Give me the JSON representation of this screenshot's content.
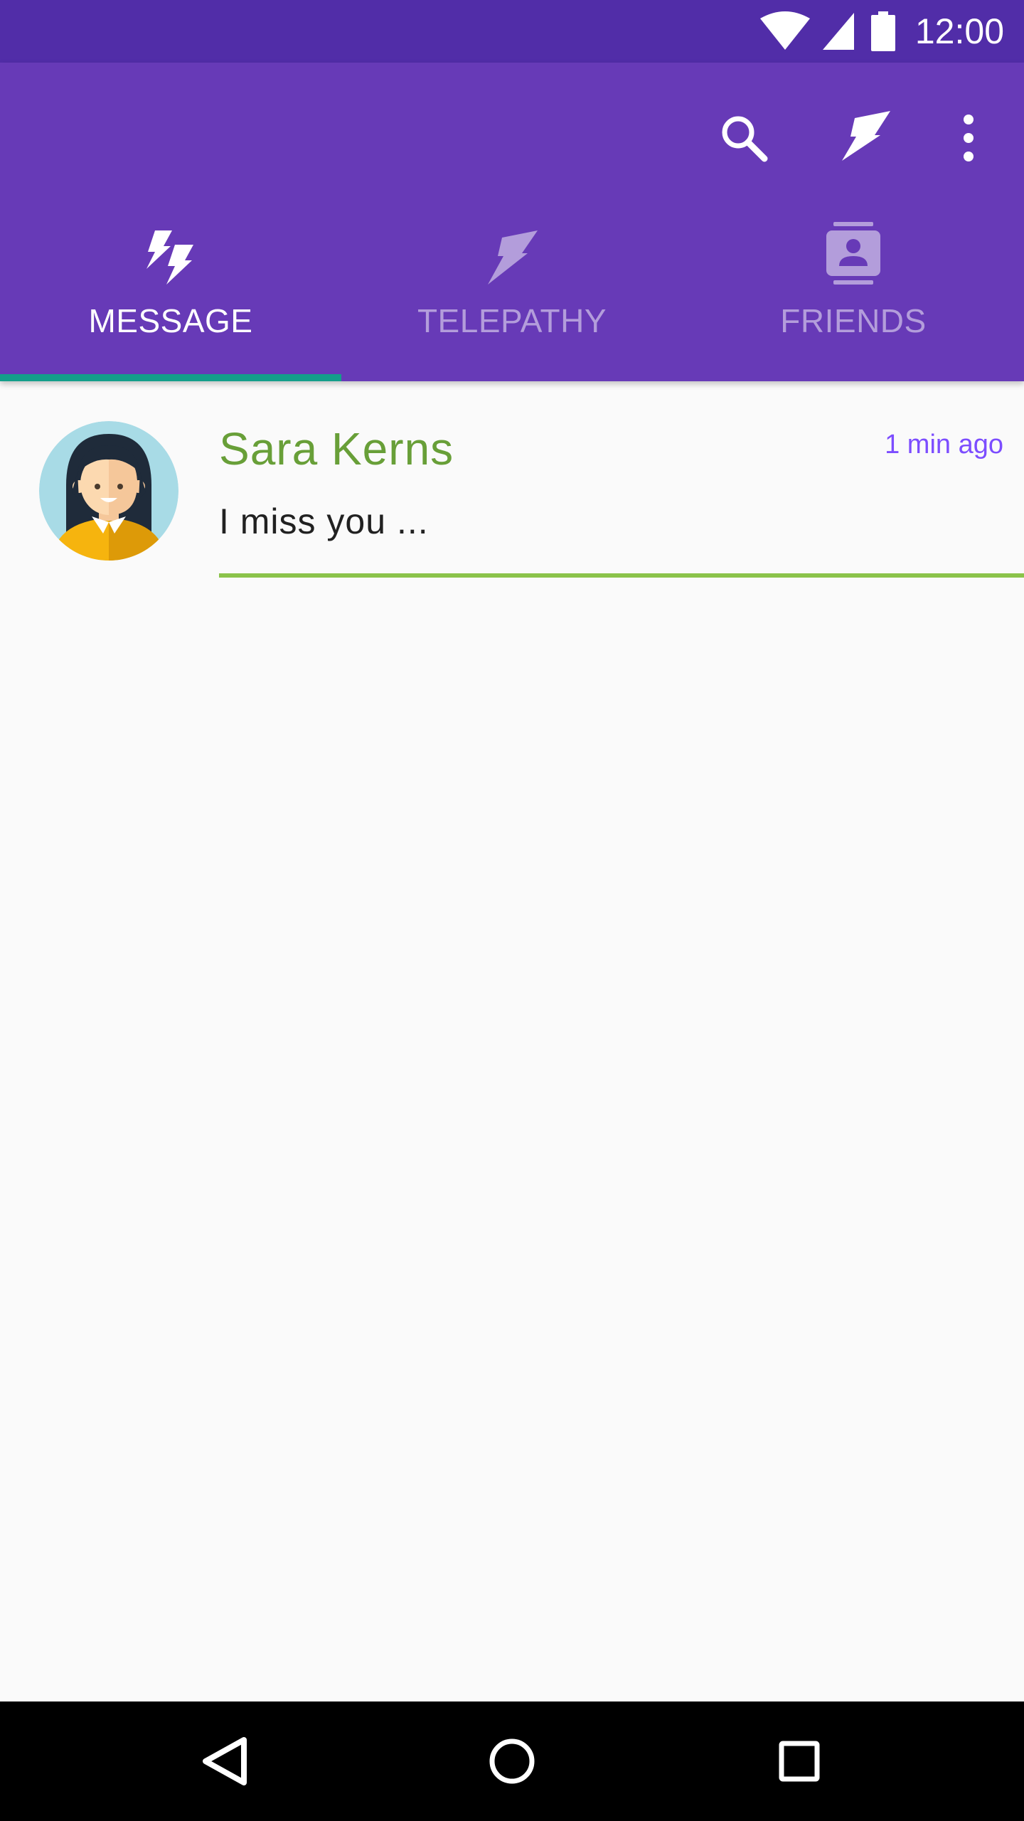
{
  "status_bar": {
    "time": "12:00",
    "icons": [
      "wifi-icon",
      "cell-signal-icon",
      "battery-icon"
    ],
    "bg_color": "#512da8"
  },
  "toolbar": {
    "bg_color": "#673ab7",
    "actions": [
      "search-icon",
      "telepathy-bolt-icon",
      "more-vert-icon"
    ]
  },
  "tabs": [
    {
      "label": "MESSAGE",
      "icon": "double-bolt-icon",
      "active": true
    },
    {
      "label": "TELEPATHY",
      "icon": "bolt-icon",
      "active": false
    },
    {
      "label": "FRIENDS",
      "icon": "contacts-icon",
      "active": false
    }
  ],
  "messages": [
    {
      "name": "Sara Kerns",
      "time": "1 min ago",
      "preview": "I miss you ...",
      "avatar": "woman-avatar"
    }
  ],
  "nav_bar": {
    "buttons": [
      "back-icon",
      "home-icon",
      "recents-icon"
    ]
  },
  "colors": {
    "accent": "#7c4dff",
    "name_green": "#689f38",
    "divider_green": "#8bc34a",
    "tab_indicator": "#139e8a"
  }
}
